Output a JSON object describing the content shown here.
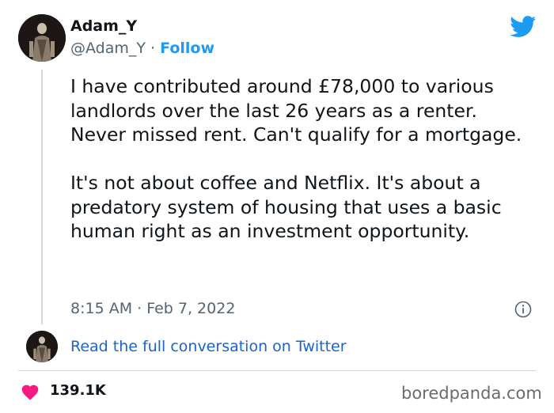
{
  "tweet": {
    "author_name": "Adam_Y",
    "handle": "@Adam_Y",
    "separator": " · ",
    "follow_label": "Follow",
    "text_paragraph_1": "I have contributed around £78,000 to various landlords over the last 26 years as a renter. Never missed rent. Can't qualify for a mortgage.",
    "text_paragraph_2": "It's not about coffee and Netflix. It's about a predatory system of housing that uses a basic human right as an investment opportunity.",
    "timestamp": "8:15 AM · Feb 7, 2022",
    "read_more_label": "Read the full conversation on Twitter",
    "like_count": "139.1K"
  },
  "icons": {
    "brand": "twitter-bird-icon",
    "info": "info-icon",
    "like": "heart-icon"
  },
  "watermark": "boredpanda.com",
  "colors": {
    "accent": "#1d9bf0",
    "link": "#1d63c7",
    "heart": "#f91880",
    "muted": "#536471",
    "text": "#0f1419"
  }
}
